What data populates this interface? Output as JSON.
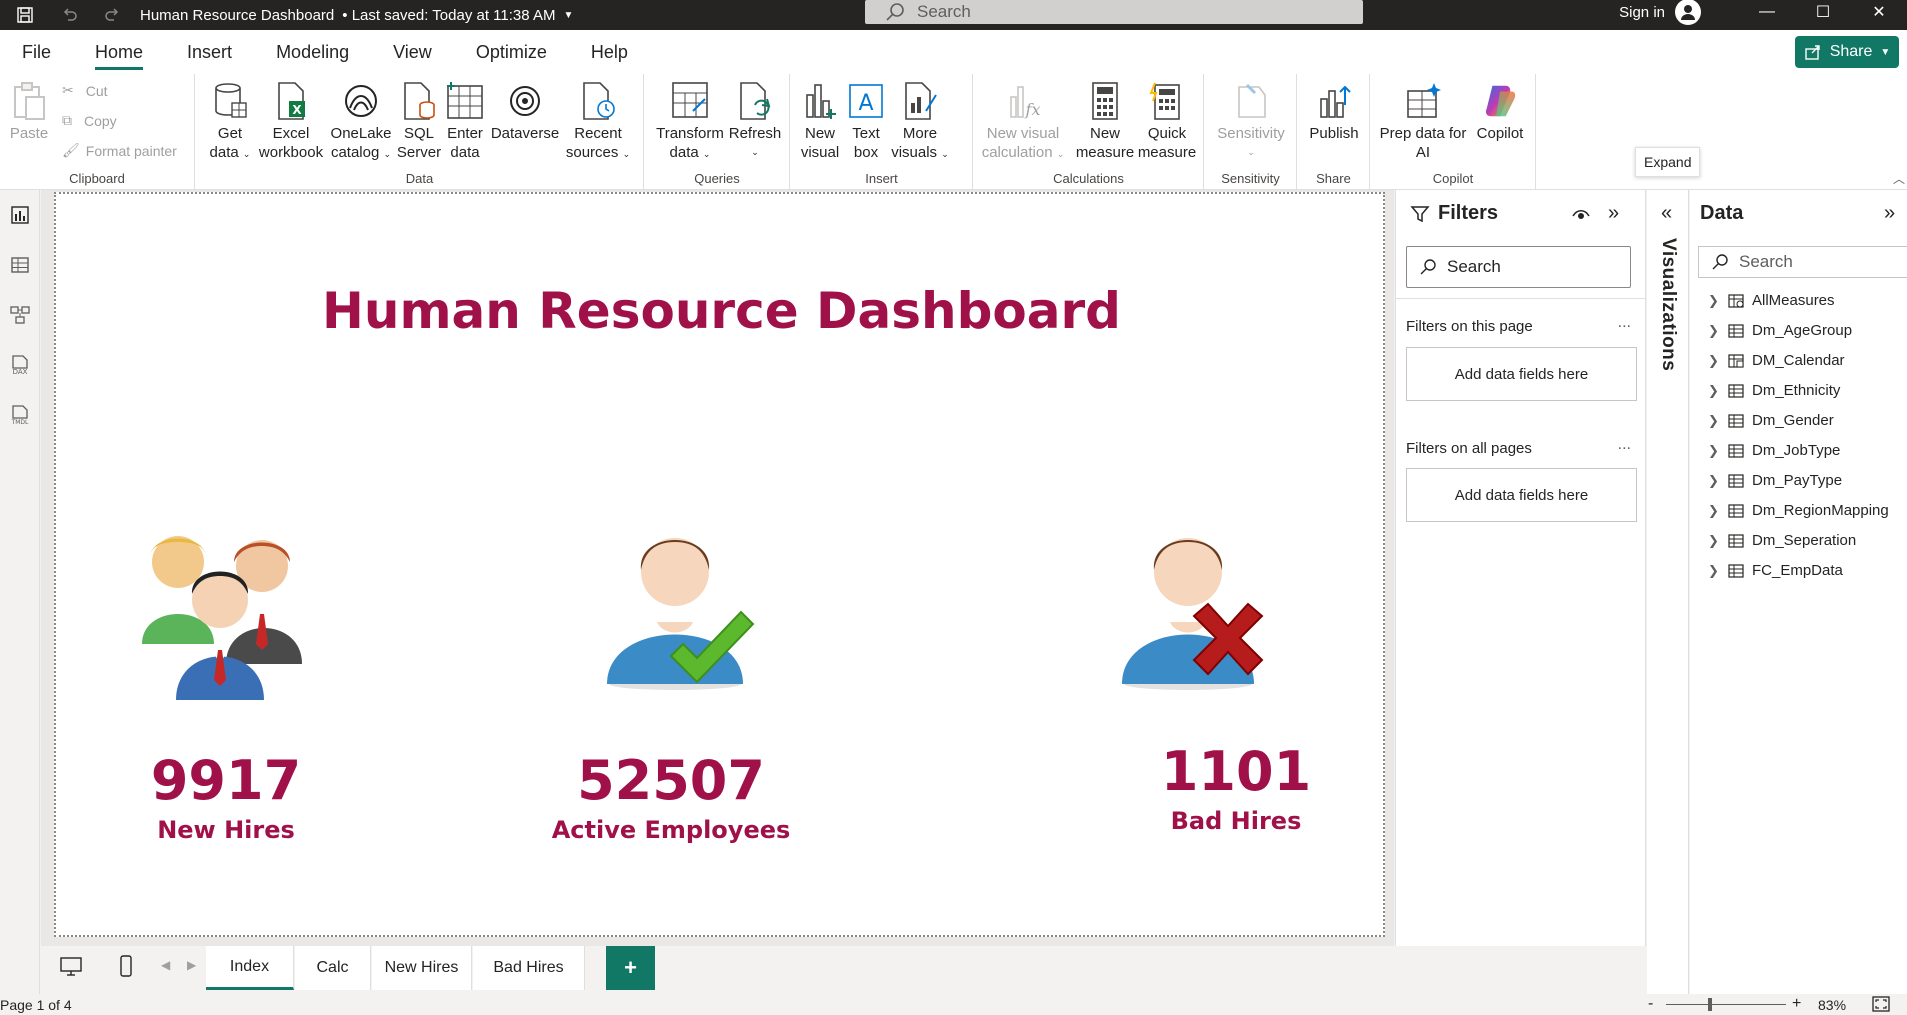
{
  "titlebar": {
    "title": "Human Resource Dashboard",
    "saved": "• Last saved: Today at 11:38 AM",
    "search_placeholder": "Search",
    "sign_in": "Sign in"
  },
  "menu": {
    "tabs": [
      "File",
      "Home",
      "Insert",
      "Modeling",
      "View",
      "Optimize",
      "Help"
    ],
    "active": "Home",
    "share_label": "Share"
  },
  "ribbon": {
    "clipboard": {
      "label": "Clipboard",
      "paste": "Paste",
      "cut": "Cut",
      "copy": "Copy",
      "format_painter": "Format painter"
    },
    "data": {
      "label": "Data",
      "get_data": [
        "Get",
        "data"
      ],
      "excel": [
        "Excel",
        "workbook"
      ],
      "onelake": [
        "OneLake",
        "catalog"
      ],
      "sql": [
        "SQL",
        "Server"
      ],
      "enter": [
        "Enter",
        "data"
      ],
      "dataverse": "Dataverse",
      "recent": [
        "Recent",
        "sources"
      ]
    },
    "queries": {
      "label": "Queries",
      "transform": [
        "Transform",
        "data"
      ],
      "refresh": "Refresh"
    },
    "insert": {
      "label": "Insert",
      "new_visual": [
        "New",
        "visual"
      ],
      "text_box": [
        "Text",
        "box"
      ],
      "more_visuals": [
        "More",
        "visuals"
      ]
    },
    "calculations": {
      "label": "Calculations",
      "new_visual_calc": [
        "New visual",
        "calculation"
      ],
      "new_measure": [
        "New",
        "measure"
      ],
      "quick_measure": [
        "Quick",
        "measure"
      ]
    },
    "sensitivity": {
      "label": "Sensitivity",
      "button": "Sensitivity"
    },
    "share": {
      "label": "Share",
      "publish": "Publish"
    },
    "copilot": {
      "label": "Copilot",
      "prep": [
        "Prep data for",
        "AI"
      ],
      "copilot": "Copilot"
    }
  },
  "canvas": {
    "title": "Human Resource Dashboard",
    "kpis": [
      {
        "value": "9917",
        "label": "New Hires"
      },
      {
        "value": "52507",
        "label": "Active Employees"
      },
      {
        "value": "1101",
        "label": "Bad Hires"
      }
    ]
  },
  "filters": {
    "title": "Filters",
    "search_placeholder": "Search",
    "this_page": "Filters on this page",
    "all_pages": "Filters on all pages",
    "add_fields": "Add data fields here",
    "more": "..."
  },
  "visualizations": {
    "label": "Visualizations",
    "tooltip": "Expand"
  },
  "data_pane": {
    "title": "Data",
    "search_placeholder": "Search",
    "tables": [
      "AllMeasures",
      "Dm_AgeGroup",
      "DM_Calendar",
      "Dm_Ethnicity",
      "Dm_Gender",
      "Dm_JobType",
      "Dm_PayType",
      "Dm_RegionMapping",
      "Dm_Seperation",
      "FC_EmpData"
    ]
  },
  "pages": {
    "tabs": [
      "Index",
      "Calc",
      "New Hires",
      "Bad Hires"
    ],
    "active": "Index",
    "add": "+"
  },
  "status": {
    "page": "Page 1 of 4",
    "zoom": "83%",
    "minus": "-",
    "plus": "+"
  },
  "colors": {
    "accent": "#117865",
    "kpi": "#a0114a",
    "titlebar": "#252423"
  }
}
